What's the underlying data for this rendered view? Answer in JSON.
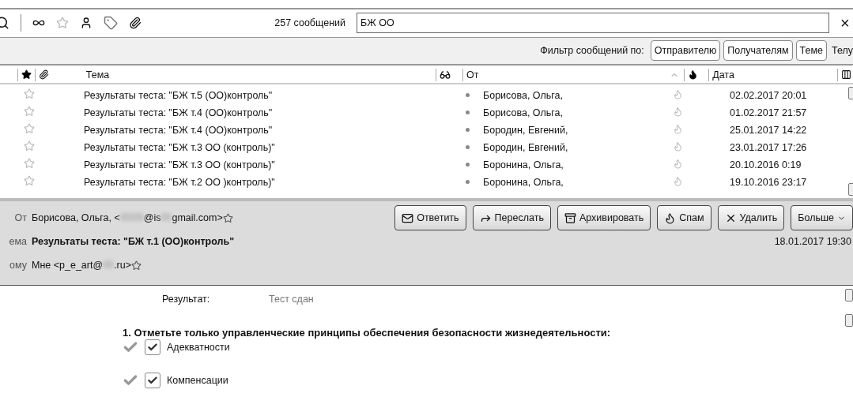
{
  "toolbar": {
    "message_count": "257 сообщений",
    "search": {
      "value": "БЖ ОО"
    },
    "clear": "×"
  },
  "filter_bar": {
    "label": "Фильтр сообщений по:",
    "buttons": [
      "Отправителю",
      "Получателям",
      "Теме",
      "Телу"
    ]
  },
  "table": {
    "columns": [
      "Тема",
      "От",
      "Дата"
    ],
    "rows": [
      {
        "starred": false,
        "subject": "Результаты теста: \"БЖ т.5 (ОО)контроль\"",
        "from": "Борисова, Ольга,",
        "date": "02.02.2017 20:01"
      },
      {
        "starred": false,
        "subject": "Результаты теста: \"БЖ т.4 (ОО)контроль\"",
        "from": "Борисова, Ольга,",
        "date": "01.02.2017 21:57"
      },
      {
        "starred": false,
        "subject": "Результаты теста: \"БЖ т.4 (ОО)контроль\"",
        "from": "Бородин, Евгений,",
        "date": "25.01.2017 14:22"
      },
      {
        "starred": false,
        "subject": "Результаты теста: \"БЖ т.3 ОО (контроль)\"",
        "from": "Бородин, Евгений,",
        "date": "23.01.2017 17:26"
      },
      {
        "starred": false,
        "subject": "Результаты теста: \"БЖ т.3 ОО (контроль)\"",
        "from": "Боронина, Ольга,",
        "date": "20.10.2016 0:19"
      },
      {
        "starred": false,
        "subject": "Результаты теста: \"БЖ т.2 ОО )контроль)\"",
        "from": "Боронина, Ольга,",
        "date": "19.10.2016 23:17"
      }
    ]
  },
  "message": {
    "from_label": "От",
    "from_name": "Борисова, Ольга,",
    "from_email_parts": [
      "<",
      "@is",
      "gmail.com>"
    ],
    "from_starred": false,
    "subject_label": "ема",
    "subject": "Результаты теста: \"БЖ т.1 (ОО)контроль\"",
    "date": "18.01.2017 19:30",
    "to_label": "ому",
    "to_parts": [
      "Мне <p_e_art@",
      ".ru>"
    ],
    "to_starred": false,
    "actions": [
      {
        "kind": "reply",
        "label": "Ответить"
      },
      {
        "kind": "forward",
        "label": "Переслать"
      },
      {
        "kind": "archive",
        "label": "Архивировать"
      },
      {
        "kind": "spam",
        "label": "Спам"
      },
      {
        "kind": "delete",
        "label": "Удалить"
      },
      {
        "kind": "more",
        "label": "Больше"
      }
    ]
  },
  "body": {
    "result_label": "Результат:",
    "result_value": "Тест сдан",
    "question": "**1.** Отметьте только управленческие принципы обеспечения безопасности жизнедеятельности:",
    "answers": [
      {
        "label": "Адекватности",
        "checked": true,
        "correct": true
      },
      {
        "label": "Компенсации",
        "checked": true,
        "correct": true
      }
    ]
  }
}
